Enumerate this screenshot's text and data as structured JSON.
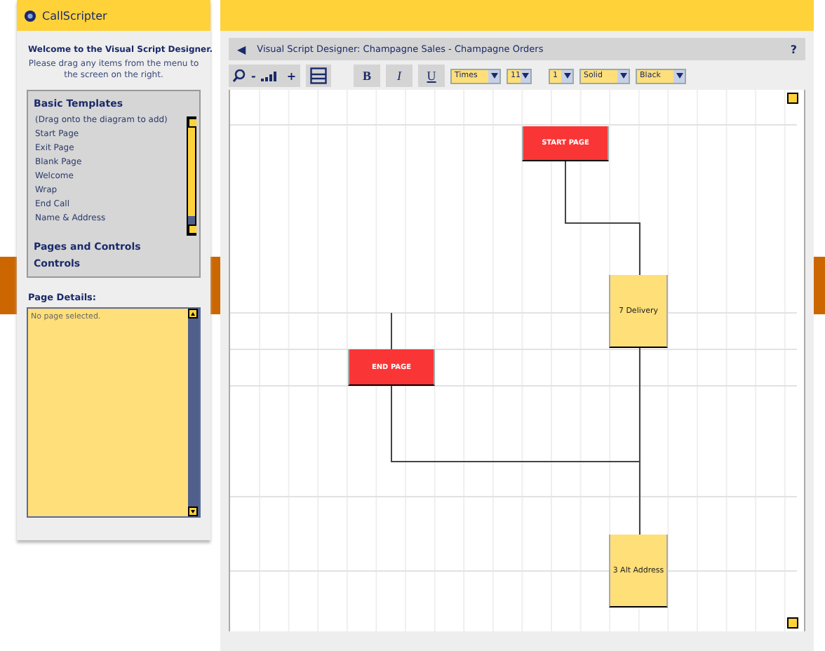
{
  "app": {
    "name": "CallScripter"
  },
  "welcome": {
    "title": "Welcome to the Visual Script Designer.",
    "text": "Please drag any items from the menu to the screen on the right."
  },
  "menu": {
    "sections": [
      {
        "title": "Basic Templates",
        "items": [
          "(Drag onto the diagram to add)",
          "Start Page",
          "Exit Page",
          "Blank Page",
          "Welcome",
          "Wrap",
          "End Call",
          "Name & Address"
        ]
      },
      {
        "title": "Pages and Controls"
      },
      {
        "title": "Controls"
      }
    ]
  },
  "page_details": {
    "label": "Page Details:",
    "placeholder": "No page selected."
  },
  "designer": {
    "back": "◀",
    "breadcrumb": "Visual Script Designer: Champagne Sales - Champagne Orders",
    "help": "?"
  },
  "toolbar": {
    "zoom_out": "-",
    "zoom_in": "+",
    "format": [
      "B",
      "I",
      "U"
    ],
    "selects": [
      "Times",
      "11",
      "1",
      "Solid",
      "Black"
    ]
  },
  "diagram": {
    "nodes": [
      {
        "label": "START PAGE",
        "kind": "terminal"
      },
      {
        "label": "7 Delivery",
        "kind": "page"
      },
      {
        "label": "END PAGE",
        "kind": "terminal"
      },
      {
        "label": "3 Alt Address",
        "kind": "page"
      }
    ]
  }
}
